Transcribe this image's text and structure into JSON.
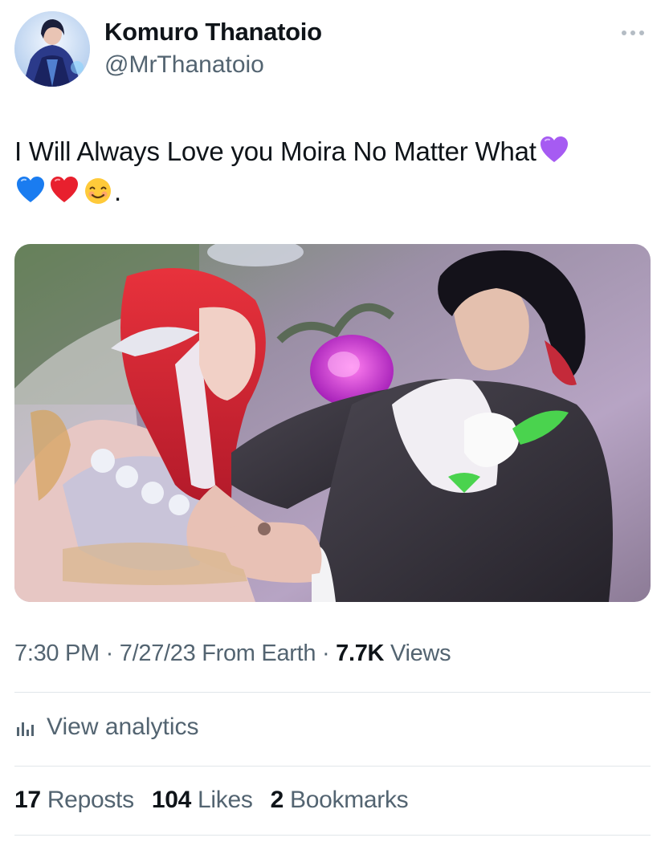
{
  "author": {
    "display_name": "Komuro Thanatoio",
    "handle": "@MrThanatoio",
    "avatar_icon": "avatar"
  },
  "tweet": {
    "line1": "I Will Always Love you Moira No Matter What",
    "line2_suffix": ".",
    "emojis": [
      "purple-heart",
      "blue-heart",
      "red-heart",
      "smiling-face"
    ]
  },
  "media": {
    "alt_icon": "wedding-image"
  },
  "meta": {
    "time": "7:30 PM",
    "sep1": " · ",
    "date": "7/27/23",
    "source": " From Earth",
    "sep2": " · ",
    "views_count": "7.7K",
    "views_label": " Views"
  },
  "analytics": {
    "label": "View analytics"
  },
  "stats": {
    "reposts_count": "17",
    "reposts_label": " Reposts",
    "likes_count": "104",
    "likes_label": " Likes",
    "bookmarks_count": "2",
    "bookmarks_label": " Bookmarks"
  },
  "colors": {
    "text_primary": "#0f1419",
    "text_secondary": "#536471",
    "divider": "#e1e6ea"
  }
}
